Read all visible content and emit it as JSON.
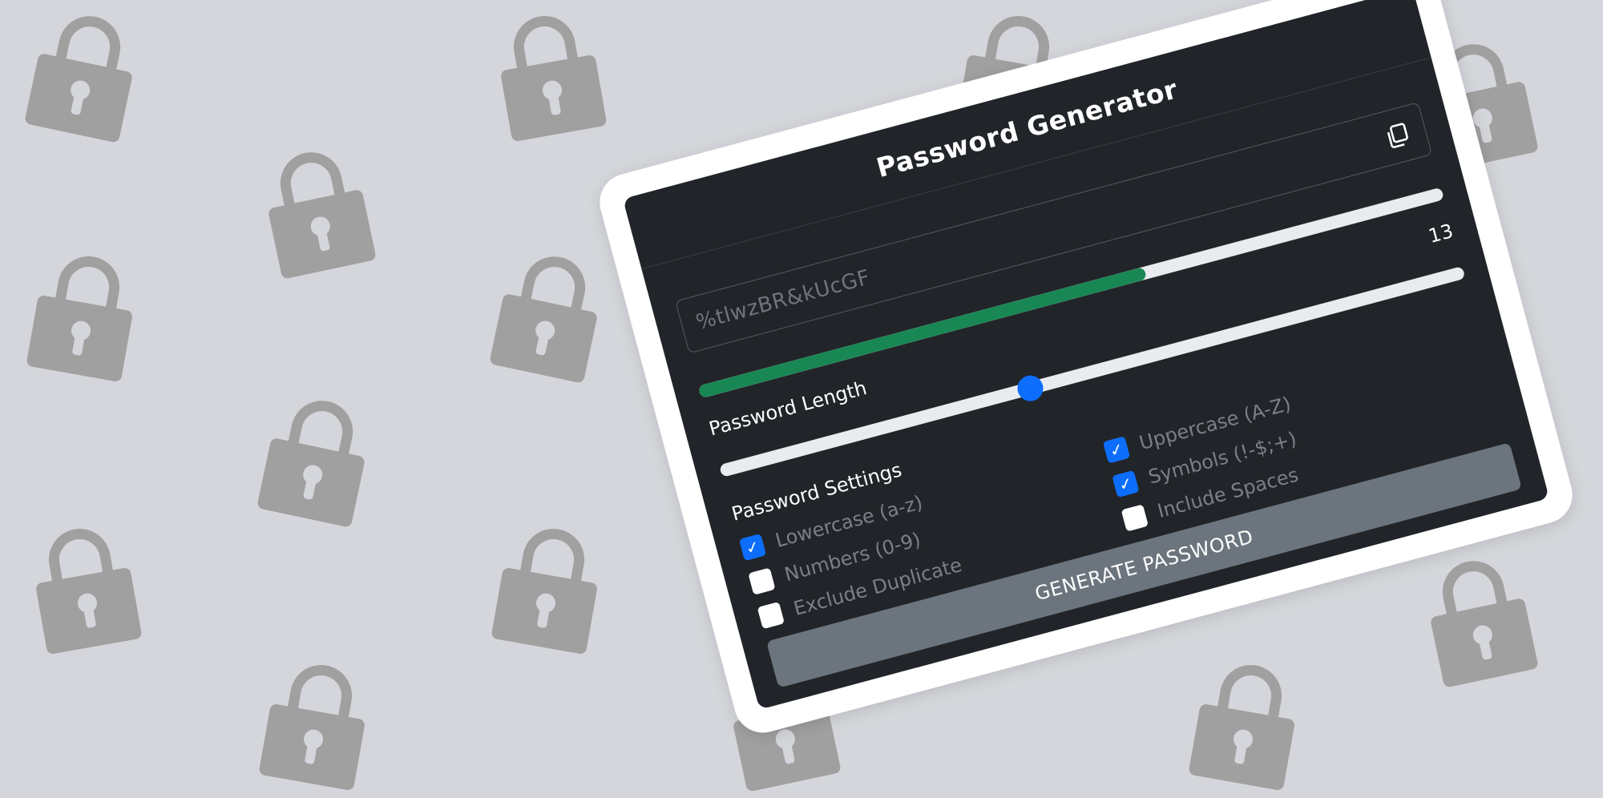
{
  "header": {
    "title": "Password Generator"
  },
  "password": {
    "value": "%tlwzBR&kUcGF"
  },
  "strength": {
    "fraction": 0.6,
    "color": "#198754"
  },
  "length": {
    "label": "Password Length",
    "value": "13",
    "min": 1,
    "max": 30
  },
  "settings": {
    "label": "Password Settings",
    "options": [
      {
        "label": "Lowercase (a-z)",
        "checked": true
      },
      {
        "label": "Uppercase (A-Z)",
        "checked": true
      },
      {
        "label": "Numbers (0-9)",
        "checked": false
      },
      {
        "label": "Symbols (!-$;+)",
        "checked": true
      },
      {
        "label": "Exclude Duplicate",
        "checked": false
      },
      {
        "label": "Include Spaces",
        "checked": false
      }
    ]
  },
  "actions": {
    "generate_label": "GENERATE PASSWORD"
  },
  "colors": {
    "background": "#d4d6db",
    "lock": "#a0a0a0",
    "card": "#212529",
    "accent": "#0d6efd",
    "button": "#6c757d"
  },
  "icons": {
    "background": "lock-icon",
    "copy": "copy-icon",
    "check": "check-icon"
  }
}
